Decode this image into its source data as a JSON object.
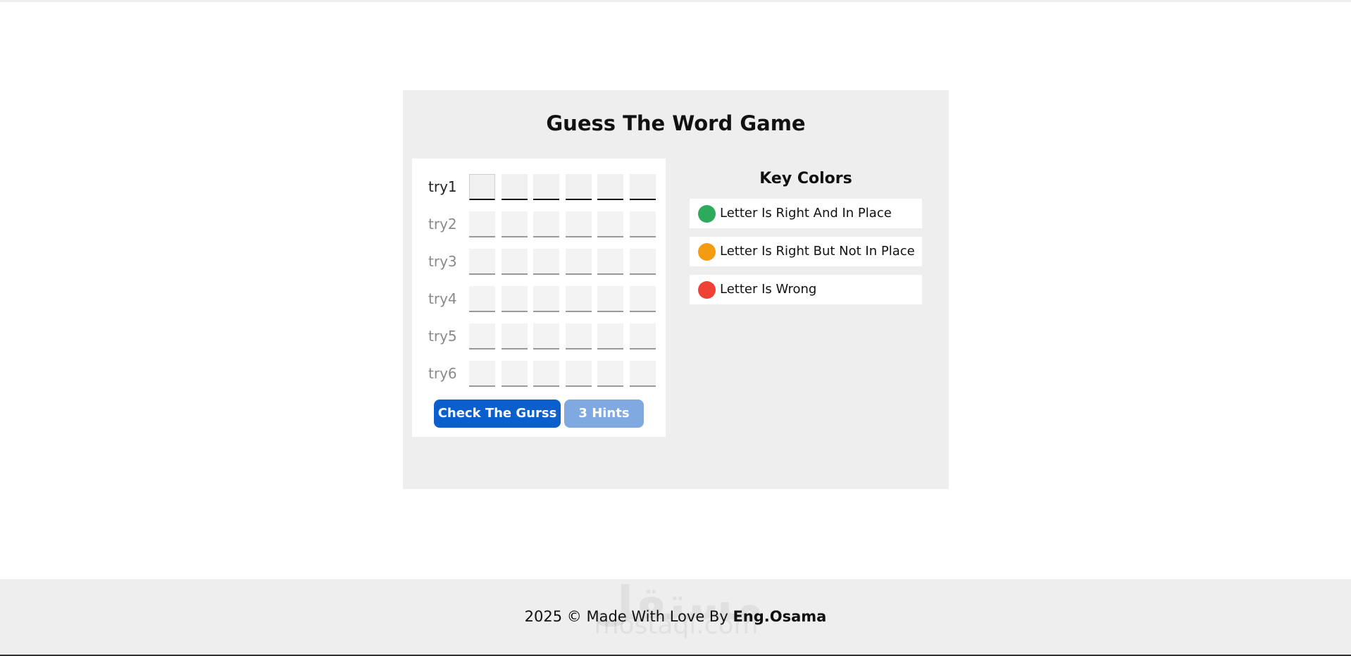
{
  "title": "Guess The Word Game",
  "tries": [
    {
      "label": "try1",
      "active": true,
      "letters": [
        "",
        "",
        "",
        "",
        "",
        ""
      ]
    },
    {
      "label": "try2",
      "active": false,
      "letters": [
        "",
        "",
        "",
        "",
        "",
        ""
      ]
    },
    {
      "label": "try3",
      "active": false,
      "letters": [
        "",
        "",
        "",
        "",
        "",
        ""
      ]
    },
    {
      "label": "try4",
      "active": false,
      "letters": [
        "",
        "",
        "",
        "",
        "",
        ""
      ]
    },
    {
      "label": "try5",
      "active": false,
      "letters": [
        "",
        "",
        "",
        "",
        "",
        ""
      ]
    },
    {
      "label": "try6",
      "active": false,
      "letters": [
        "",
        "",
        "",
        "",
        "",
        ""
      ]
    }
  ],
  "buttons": {
    "check_label": "Check The Gurss",
    "hints_label": "3 Hints"
  },
  "key_colors": {
    "title": "Key Colors",
    "items": [
      {
        "text": "Letter Is Right And In Place",
        "color": "#2eaa5c"
      },
      {
        "text": "Letter Is Right But Not In Place",
        "color": "#f39c12"
      },
      {
        "text": "Letter Is Wrong",
        "color": "#ef4136"
      }
    ]
  },
  "footer": {
    "text": "2025 © Made With Love By ",
    "author": "Eng.Osama"
  },
  "watermark": {
    "arabic": "مستقل",
    "latin": "mostaql.com"
  }
}
